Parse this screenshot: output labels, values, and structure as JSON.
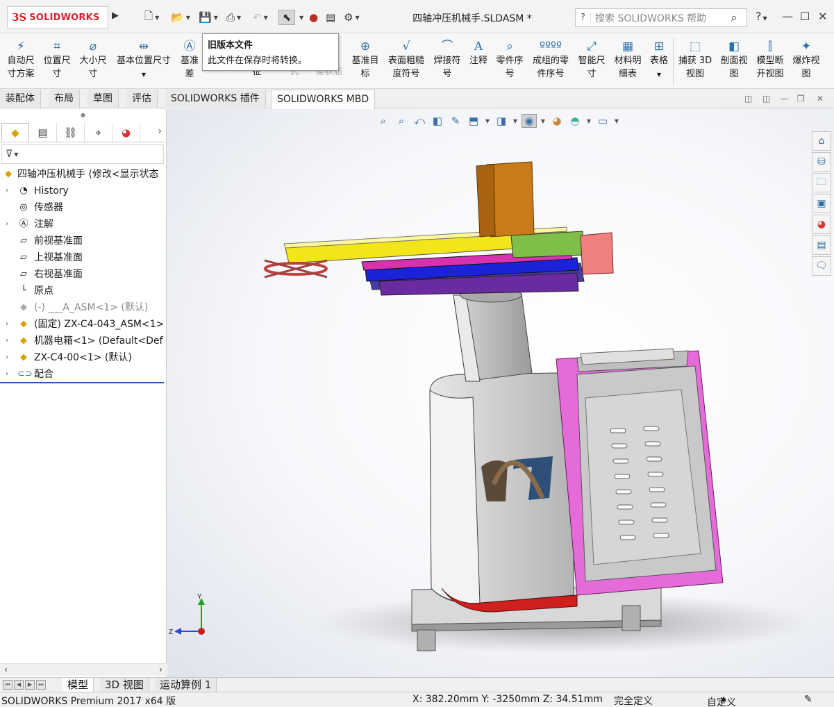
{
  "app": {
    "logo_ds": "3S",
    "logo_text": "SOLIDWORKS",
    "document_title": "四轴冲压机械手.SLDASM *"
  },
  "search": {
    "placeholder": "搜索 SOLIDWORKS 帮助"
  },
  "titlebar": {
    "help_label": "?"
  },
  "tooltip": {
    "title": "旧版本文件",
    "body": "此文件在保存时将转换。"
  },
  "ribbon": {
    "buttons": [
      {
        "label": "自动尺\n寸方案",
        "icon": "auto-dimension-icon"
      },
      {
        "label": "位置尺\n寸",
        "icon": "location-dimension-icon"
      },
      {
        "label": "大小尺\n寸",
        "icon": "size-dimension-icon"
      },
      {
        "label": "基本位置尺寸",
        "icon": "basic-location-dimension-icon"
      },
      {
        "label": "基准\n差",
        "icon": "datum-icon"
      },
      {
        "label": "\n征",
        "icon": "feature-icon"
      },
      {
        "label": "\n式",
        "icon": "style-icon"
      },
      {
        "label": "\n差状态",
        "icon": "tolerance-status-icon"
      },
      {
        "label": "基准目\n标",
        "icon": "datum-target-icon"
      },
      {
        "label": "表面粗糙\n度符号",
        "icon": "surface-finish-icon"
      },
      {
        "label": "焊接符\n号",
        "icon": "weld-symbol-icon"
      },
      {
        "label": "注释",
        "icon": "note-icon"
      },
      {
        "label": "零件序\n号",
        "icon": "balloon-icon"
      },
      {
        "label": "成组的零\n件序号",
        "icon": "stacked-balloon-icon"
      },
      {
        "label": "智能尺\n寸",
        "icon": "smart-dimension-icon"
      },
      {
        "label": "材料明\n细表",
        "icon": "bom-icon"
      },
      {
        "label": "表格",
        "icon": "table-icon"
      },
      {
        "label": "捕获 3D\n视图",
        "icon": "capture-3d-view-icon"
      },
      {
        "label": "剖面视\n图",
        "icon": "section-view-icon"
      },
      {
        "label": "模型断\n开视图",
        "icon": "model-break-view-icon"
      },
      {
        "label": "爆炸视\n图",
        "icon": "explode-view-icon"
      }
    ]
  },
  "tabs": [
    {
      "label": "装配体"
    },
    {
      "label": "布局"
    },
    {
      "label": "草图"
    },
    {
      "label": "评估"
    },
    {
      "label": "SOLIDWORKS 插件"
    },
    {
      "label": "SOLIDWORKS MBD"
    }
  ],
  "tree": {
    "root": "四轴冲压机械手 (修改<显示状态",
    "items": [
      {
        "label": "History",
        "icon": "history-icon",
        "expandable": true
      },
      {
        "label": "传感器",
        "icon": "sensor-icon",
        "expandable": false
      },
      {
        "label": "注解",
        "icon": "annotation-icon",
        "expandable": true
      },
      {
        "label": "前视基准面",
        "icon": "plane-icon",
        "expandable": false
      },
      {
        "label": "上视基准面",
        "icon": "plane-icon",
        "expandable": false
      },
      {
        "label": "右视基准面",
        "icon": "plane-icon",
        "expandable": false
      },
      {
        "label": "原点",
        "icon": "origin-icon",
        "expandable": false
      },
      {
        "label": "(-) ___A_ASM<1> (默认)",
        "icon": "assembly-icon",
        "expandable": false
      },
      {
        "label": "(固定) ZX-C4-043_ASM<1>",
        "icon": "assembly-icon",
        "expandable": true
      },
      {
        "label": "机器电箱<1> (Default<Def",
        "icon": "assembly-icon",
        "expandable": true
      },
      {
        "label": "ZX-C4-00<1> (默认)",
        "icon": "assembly-icon",
        "expandable": true
      },
      {
        "label": "配合",
        "icon": "mates-icon",
        "expandable": true
      }
    ]
  },
  "bottom_tabs": [
    {
      "label": "模型"
    },
    {
      "label": "3D 视图"
    },
    {
      "label": "运动算例 1"
    }
  ],
  "status": {
    "product": "SOLIDWORKS Premium 2017 x64 版",
    "coordinates": "X: 382.20mm Y: -3250mm Z: 34.51mm",
    "definition": "完全定义",
    "units": "自定义"
  },
  "triad": {
    "y": "Y",
    "z": "Z"
  },
  "colors": {
    "accent": "#1e5fb4",
    "logo": "#d8202a"
  }
}
